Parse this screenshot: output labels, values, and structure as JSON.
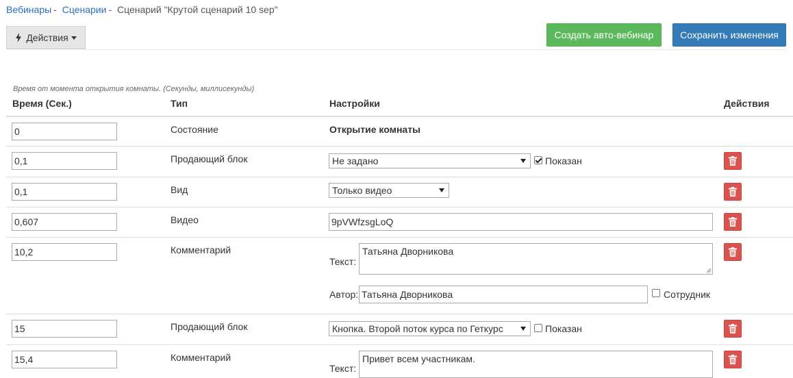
{
  "breadcrumb": {
    "items": [
      {
        "label": "Вебинары",
        "link": true
      },
      {
        "label": "Сценарии",
        "link": true
      },
      {
        "label": "Сценарий \"Крутой сценарий 10 sep\"",
        "link": false
      }
    ],
    "separator": "-"
  },
  "toolbar": {
    "actions_label": "Действия",
    "create_label": "Создать авто-вебинар",
    "save_label": "Сохранить изменения"
  },
  "table": {
    "hint": "Время от момента открытия комнаты. (Секунды, миллисекунды)",
    "headers": {
      "time": "Время (Сек.)",
      "type": "Тип",
      "settings": "Настройки",
      "actions": "Действия"
    },
    "rows": [
      {
        "time": "0",
        "type": "Состояние",
        "settings_text": "Открытие комнаты"
      },
      {
        "time": "0,1",
        "type": "Продающий блок",
        "select": "Не задано",
        "checkbox_label": "Показан",
        "checked": true
      },
      {
        "time": "0,1",
        "type": "Вид",
        "select": "Только видео"
      },
      {
        "time": "0,607",
        "type": "Видео",
        "value": "9pVWfzsgLoQ"
      },
      {
        "time": "10,2",
        "type": "Комментарий",
        "text_label": "Текст:",
        "text": "Татьяна Дворникова",
        "author_label": "Автор:",
        "author": "Татьяна Дворникова",
        "staff_label": "Сотрудник",
        "staff_checked": false
      },
      {
        "time": "15",
        "type": "Продающий блок",
        "select": "Кнопка. Второй поток курса по Геткурс",
        "checkbox_label": "Показан",
        "checked": false
      },
      {
        "time": "15,4",
        "type": "Комментарий",
        "text_label": "Текст:",
        "text": "Привет всем участникам."
      }
    ]
  },
  "colors": {
    "link": "#2a6ebb",
    "success": "#5cb85c",
    "primary": "#337ab7",
    "danger": "#d9534f"
  },
  "icons": {
    "actions": "bolt-icon",
    "dropdown": "caret-down-icon",
    "delete": "trash-icon"
  }
}
